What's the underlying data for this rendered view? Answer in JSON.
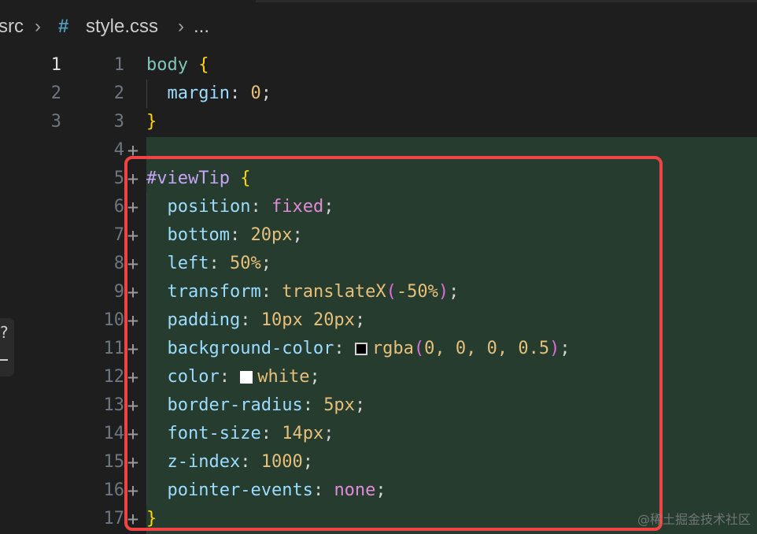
{
  "breadcrumb": {
    "folder": "src",
    "file_icon": "hash-icon",
    "file": "style.css",
    "more": "..."
  },
  "left_pane": {
    "line_numbers": [
      "1",
      "2",
      "3"
    ]
  },
  "right_pane": {
    "line_numbers": [
      "1",
      "2",
      "3",
      "4",
      "5",
      "6",
      "7",
      "8",
      "9",
      "10",
      "11",
      "12",
      "13",
      "14",
      "15",
      "16",
      "17"
    ],
    "added_marker": "+",
    "added_from_line": 4
  },
  "code": {
    "line1": {
      "selector": "body",
      "brace": "{"
    },
    "line2": {
      "prop": "margin",
      "value": "0"
    },
    "line3": {
      "brace": "}"
    },
    "line5": {
      "selector": "#viewTip",
      "brace": "{"
    },
    "line6": {
      "prop": "position",
      "value": "fixed"
    },
    "line7": {
      "prop": "bottom",
      "value": "20px"
    },
    "line8": {
      "prop": "left",
      "value": "50%"
    },
    "line9": {
      "prop": "transform",
      "fn": "translateX",
      "arg": "-50%"
    },
    "line10": {
      "prop": "padding",
      "value": "10px 20px"
    },
    "line11": {
      "prop": "background-color",
      "fn": "rgba",
      "args": "0, 0, 0, 0.5",
      "swatch_color": "#000000"
    },
    "line12": {
      "prop": "color",
      "value": "white",
      "swatch_color": "#ffffff"
    },
    "line13": {
      "prop": "border-radius",
      "value": "5px"
    },
    "line14": {
      "prop": "font-size",
      "value": "14px"
    },
    "line15": {
      "prop": "z-index",
      "value": "1000"
    },
    "line16": {
      "prop": "pointer-events",
      "value": "none"
    },
    "line17": {
      "brace": "}"
    }
  },
  "colors": {
    "added_background": "#253c2f",
    "highlight_border": "#ef4444"
  },
  "watermark": "@稀土掘金技术社区"
}
